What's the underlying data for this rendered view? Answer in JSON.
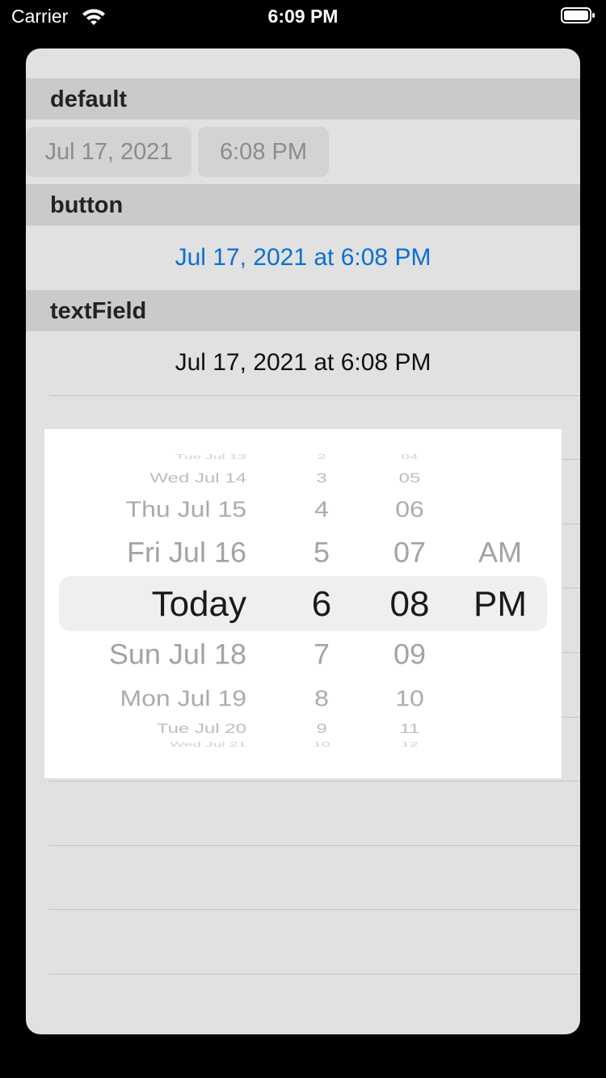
{
  "status_bar": {
    "carrier": "Carrier",
    "time": "6:09 PM"
  },
  "sections": {
    "default": {
      "header": "default",
      "date_value": "Jul 17, 2021",
      "time_value": "6:08 PM"
    },
    "button": {
      "header": "button",
      "value": "Jul 17, 2021 at 6:08 PM"
    },
    "textField": {
      "header": "textField",
      "value": "Jul 17, 2021 at 6:08 PM"
    }
  },
  "picker": {
    "selected": {
      "day": "Today",
      "hour": "6",
      "minute": "08",
      "meridiem": "PM"
    },
    "days": [
      "Tue Jul 13",
      "Wed Jul 14",
      "Thu Jul 15",
      "Fri Jul 16",
      "Today",
      "Sun Jul 18",
      "Mon Jul 19",
      "Tue Jul 20",
      "Wed Jul 21"
    ],
    "hours": [
      "2",
      "3",
      "4",
      "5",
      "6",
      "7",
      "8",
      "9",
      "10"
    ],
    "minutes": [
      "04",
      "05",
      "06",
      "07",
      "08",
      "09",
      "10",
      "11",
      "12"
    ],
    "meridiem": [
      "AM",
      "PM"
    ]
  },
  "colors": {
    "accent": "#0a70d6",
    "background": "#000000",
    "sheet": "#e1e1e1",
    "header": "#cacaca"
  }
}
